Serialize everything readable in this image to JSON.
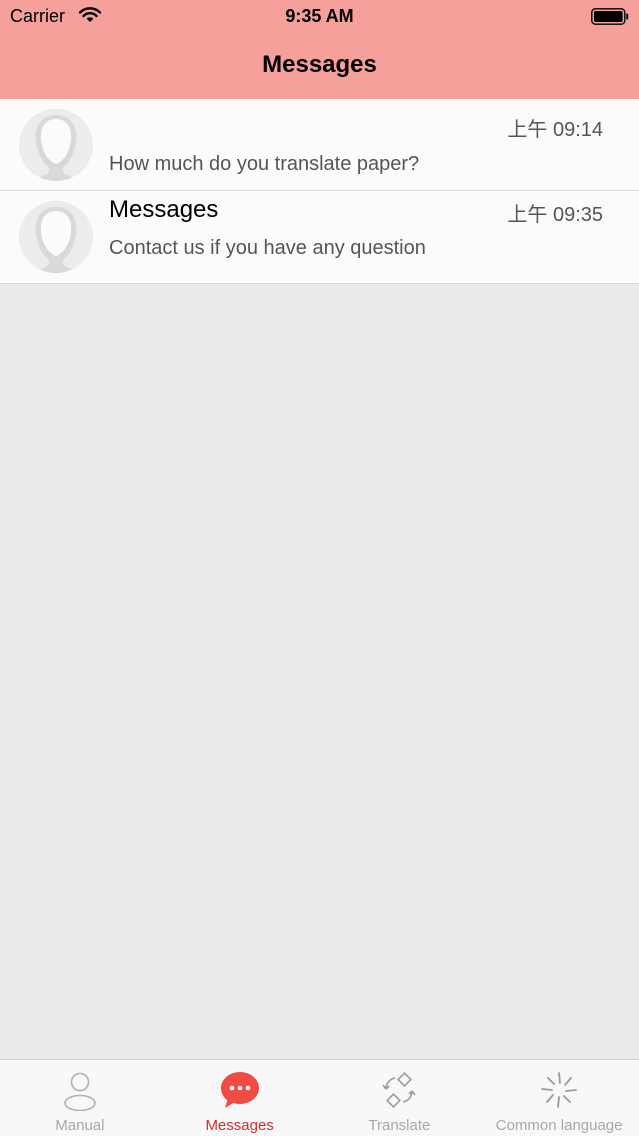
{
  "status_bar": {
    "carrier": "Carrier",
    "time": "9:35 AM"
  },
  "nav": {
    "title": "Messages"
  },
  "messages": [
    {
      "title": "",
      "time": "上午 09:14",
      "preview": "How much do you translate paper?"
    },
    {
      "title": "Messages",
      "time": "上午 09:35",
      "preview": "Contact us if you have any question"
    }
  ],
  "tabbar": {
    "tabs": [
      {
        "label": "Manual",
        "icon": "person-icon",
        "active": false
      },
      {
        "label": "Messages",
        "icon": "chat-bubble-icon",
        "active": true
      },
      {
        "label": "Translate",
        "icon": "translate-icon",
        "active": false
      },
      {
        "label": "Common language",
        "icon": "sparkle-icon",
        "active": false
      }
    ]
  },
  "colors": {
    "header": "#f6a09c",
    "accent": "#d42c2c",
    "chat_icon": "#f04b45",
    "background": "#ebeaeb"
  }
}
